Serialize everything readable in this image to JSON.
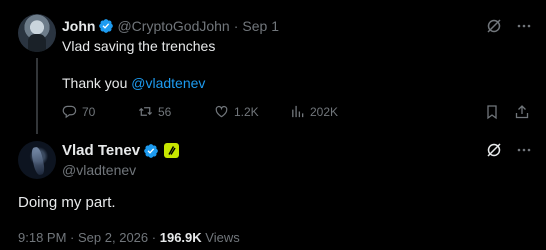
{
  "reply_tweet": {
    "author_name": "John",
    "author_handle": "@CryptoGodJohn",
    "separator": "·",
    "date": "Sep 1",
    "text_line1": "Vlad saving the trenches",
    "text_line2_prefix": "Thank you ",
    "mention": "@vladtenev",
    "reply_count": "70",
    "retweet_count": "56",
    "like_count": "1.2K",
    "view_count": "202K"
  },
  "main_tweet": {
    "author_name": "Vlad Tenev",
    "author_handle": "@vladtenev",
    "text": "Doing my part.",
    "time": "9:18 PM",
    "date": "Sep 2, 2026",
    "separator": "·",
    "views": "196.9K",
    "views_label": "Views"
  },
  "colors": {
    "background": "#000000",
    "text": "#e7e9ea",
    "muted": "#71767b",
    "link": "#1d9bf0",
    "verified": "#1d9bf0",
    "affiliate_badge": "#c7e600"
  },
  "icons": [
    "grok-icon",
    "more-icon",
    "reply-icon",
    "retweet-icon",
    "like-icon",
    "views-icon",
    "bookmark-icon",
    "share-icon",
    "verified-icon"
  ]
}
